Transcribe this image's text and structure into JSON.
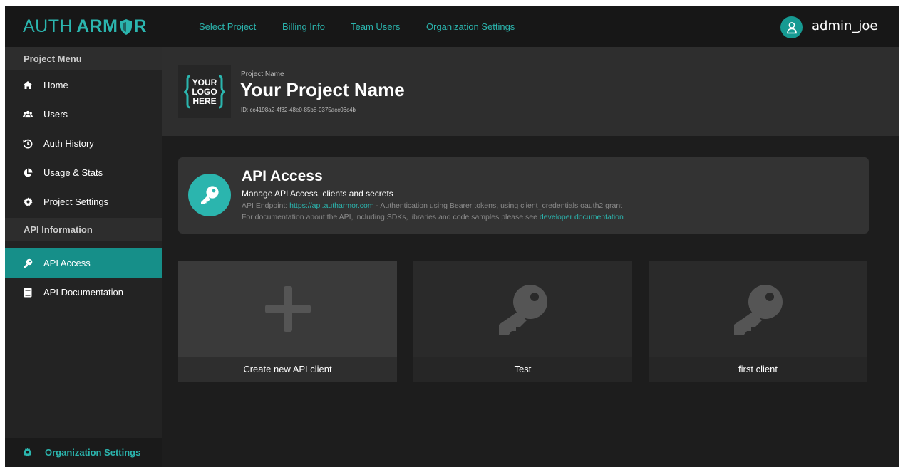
{
  "brand": {
    "logo_left": "AUTH",
    "logo_right_a": "ARM",
    "logo_right_b": "R",
    "accent": "#2bb5ae",
    "active_bg": "#168f89"
  },
  "topnav": {
    "items": [
      "Select Project",
      "Billing Info",
      "Team Users",
      "Organization Settings"
    ]
  },
  "user": {
    "name": "admin_joe",
    "avatar_icon": "user-icon"
  },
  "sidebar": {
    "project_menu_header": "Project Menu",
    "project_items": [
      {
        "label": "Home",
        "icon": "home-icon"
      },
      {
        "label": "Users",
        "icon": "users-icon"
      },
      {
        "label": "Auth History",
        "icon": "history-icon"
      },
      {
        "label": "Usage & Stats",
        "icon": "pie-chart-icon"
      },
      {
        "label": "Project Settings",
        "icon": "gear-icon"
      }
    ],
    "api_header": "API Information",
    "api_items": [
      {
        "label": "API Access",
        "icon": "key-icon",
        "active": true
      },
      {
        "label": "API Documentation",
        "icon": "book-icon"
      }
    ],
    "footer_item": {
      "label": "Organization Settings",
      "icon": "gear-icon"
    }
  },
  "project": {
    "logo_lines": [
      "YOUR",
      "LOGO",
      "HERE"
    ],
    "label": "Project Name",
    "name": "Your Project Name",
    "id_text": "ID: cc4198a2-4f82-48e0-85b8-0375acc06c4b"
  },
  "api_access": {
    "title": "API Access",
    "subtitle": "Manage API Access, clients and secrets",
    "endpoint_prefix": "API Endpoint:",
    "endpoint_url": "https://api.autharmor.com",
    "endpoint_suffix": "- Authentication using Bearer tokens, using client_credentials oauth2 grant",
    "doc_prefix": "For documentation about the API, including SDKs, libraries and code samples please see",
    "doc_link": "developer documentation"
  },
  "clients": [
    {
      "label": "Create new API client",
      "icon": "plus-icon"
    },
    {
      "label": "Test",
      "icon": "key-icon"
    },
    {
      "label": "first client",
      "icon": "key-icon"
    }
  ]
}
